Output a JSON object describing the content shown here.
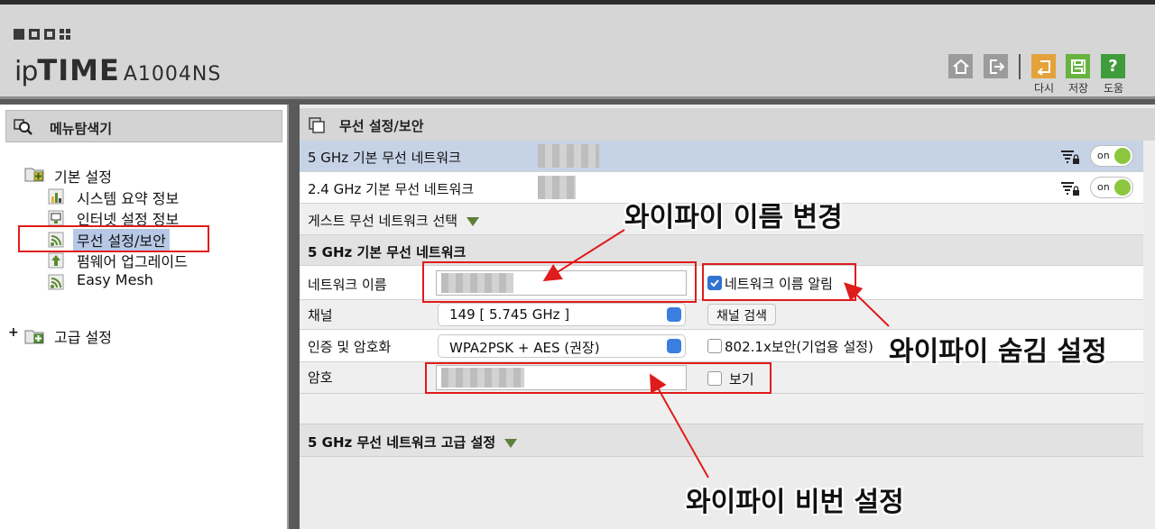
{
  "header": {
    "brand_ip": "ip",
    "brand_time": "TIME",
    "model": "A1004NS",
    "buttons": [
      {
        "icon": "home-icon",
        "label": ""
      },
      {
        "icon": "logout-icon",
        "label": ""
      },
      {
        "icon": "restart-icon",
        "label": "다시"
      },
      {
        "icon": "save-icon",
        "label": "저장"
      },
      {
        "icon": "help-icon",
        "label": "도움"
      }
    ],
    "help_glyph": "?"
  },
  "sidebar": {
    "title": "메뉴탐색기",
    "groups": [
      {
        "label": "기본 설정",
        "items": [
          {
            "label": "시스템 요약 정보",
            "icon": "bar-chart-icon"
          },
          {
            "label": "인터넷 설정 정보",
            "icon": "monitor-icon"
          },
          {
            "label": "무선 설정/보안",
            "icon": "wifi-icon",
            "selected": true
          },
          {
            "label": "펌웨어 업그레이드",
            "icon": "upload-icon"
          },
          {
            "label": "Easy Mesh",
            "icon": "mesh-icon"
          }
        ]
      },
      {
        "label": "고급 설정",
        "expander": "+"
      }
    ]
  },
  "main": {
    "title": "무선 설정/보안",
    "networks": [
      {
        "label": "5 GHz 기본 무선 네트워크",
        "toggle": "on"
      },
      {
        "label": "2.4 GHz 기본 무선 네트워크",
        "toggle": "on"
      }
    ],
    "guest_label": "게스트 무선 네트워크 선택",
    "section_title": "5 GHz 기본 무선 네트워크",
    "form": {
      "network_name_label": "네트워크 이름",
      "broadcast_label": "네트워크 이름 알림",
      "channel_label": "채널",
      "channel_value": "149 [ 5.745 GHz ]",
      "channel_scan_button": "채널 검색",
      "auth_label": "인증 및 암호화",
      "auth_value": "WPA2PSK + AES (권장)",
      "enterprise_label": "802.1x보안(기업용 설정)",
      "password_label": "암호",
      "show_label": "보기"
    },
    "advanced_title": "5 GHz 무선 네트워크 고급 설정"
  },
  "annotations": {
    "rename": "와이파이 이름 변경",
    "hide": "와이파이 숨김 설정",
    "password": "와이파이 비번 설정"
  },
  "colors": {
    "accent_red": "#e01b1b",
    "toggle_green": "#8cc63f",
    "selected_row": "#c6d2e6"
  }
}
